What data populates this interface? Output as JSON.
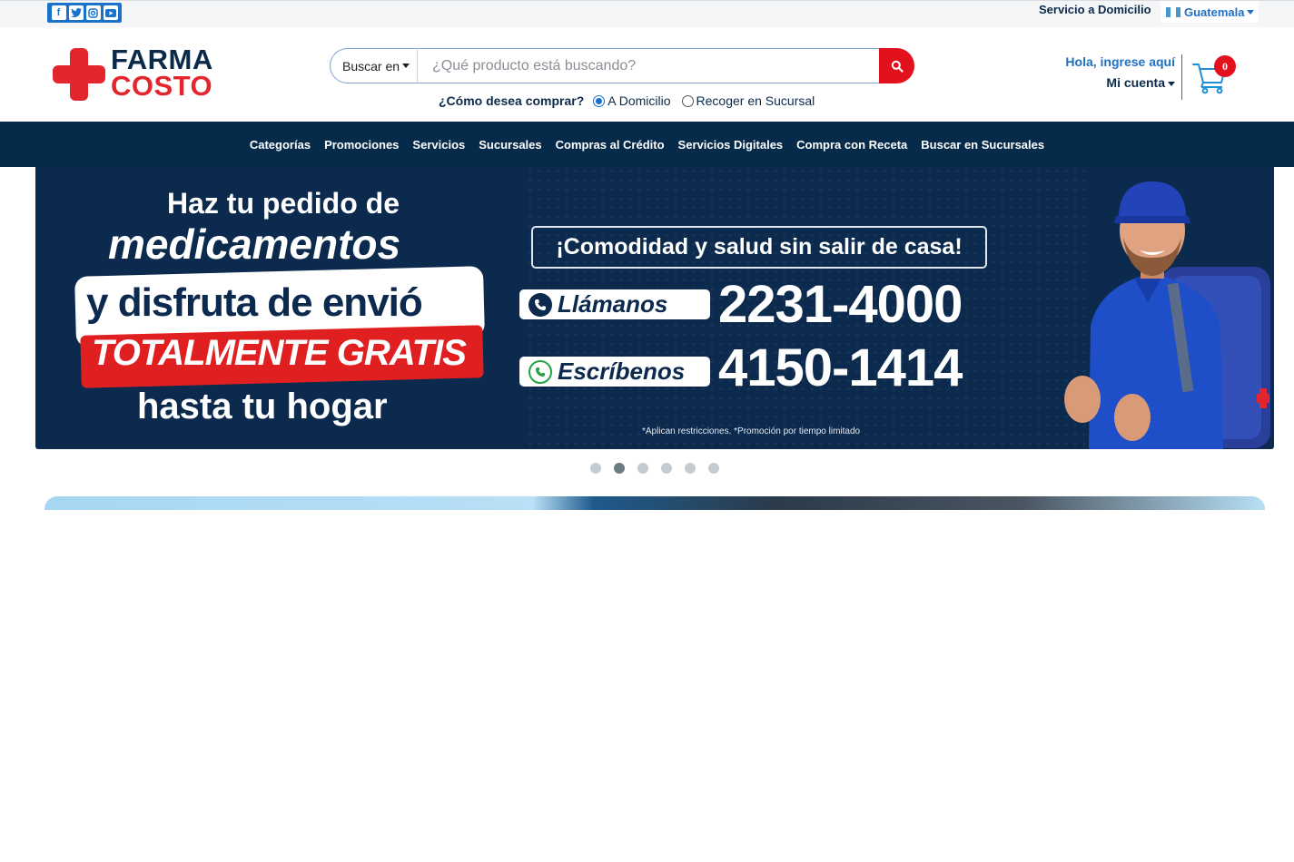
{
  "topbar": {
    "social_icons": [
      "facebook-icon",
      "twitter-icon",
      "instagram-icon",
      "youtube-icon"
    ],
    "service_link": "Servicio a Domicilio",
    "country": "Guatemala"
  },
  "header": {
    "logo_line1": "FARMA",
    "logo_line2": "COSTO",
    "search_scope": "Buscar en",
    "search_placeholder": "¿Qué producto está buscando?",
    "buy_mode_question": "¿Cómo desea comprar?",
    "buy_options": [
      {
        "label": "A Domicilio",
        "selected": true
      },
      {
        "label": "Recoger en Sucursal",
        "selected": false
      }
    ],
    "greeting": "Hola, ingrese aquí",
    "account_label": "Mi cuenta",
    "cart_count": "0"
  },
  "nav": {
    "items": [
      "Categorías",
      "Promociones",
      "Servicios",
      "Sucursales",
      "Compras al Crédito",
      "Servicios Digitales",
      "Compra con Receta",
      "Buscar en Sucursales"
    ]
  },
  "banner": {
    "line1": "Haz tu pedido de",
    "line2": "medicamentos",
    "line3": "y disfruta de envió",
    "line4": "TOTALMENTE GRATIS",
    "line5": "hasta tu hogar",
    "tagline": "¡Comodidad y salud sin salir de casa!",
    "call_label": "Llámanos",
    "call_number": "2231-4000",
    "write_label": "Escríbenos",
    "write_number": "4150-1414",
    "disclaimer": "*Aplican restricciones. *Promoción por tiempo limitado"
  },
  "carousel": {
    "slide_count": 6,
    "active_index": 1
  },
  "colors": {
    "brand_red": "#e3262e",
    "brand_navy": "#062a4a",
    "link_blue": "#1f6fc4"
  }
}
